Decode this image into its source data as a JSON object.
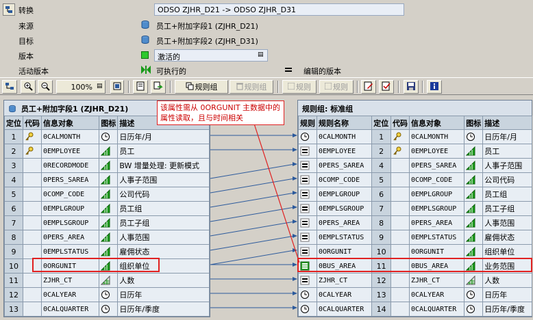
{
  "header": {
    "transform": {
      "label": "转换",
      "value": "ODSO ZJHR_D21 -> ODSO ZJHR_D31"
    },
    "source": {
      "label": "来源",
      "value": "员工+附加字段1 (ZJHR_D21)"
    },
    "target": {
      "label": "目标",
      "value": "员工+附加字段2 (ZJHR_D31)"
    },
    "version": {
      "label": "版本",
      "value": "激活的"
    },
    "active_version": {
      "label": "活动版本",
      "executable": "可执行的",
      "edited": "编辑的版本"
    }
  },
  "toolbar": {
    "zoom": "100%",
    "rule_group_active": "规则组",
    "rule_group_disabled": "规则组",
    "rule1": "规则",
    "rule2": "规则"
  },
  "callout": {
    "text": "该属性需从 0ORGUNIT 主数据中的属性读取，且与时间相关"
  },
  "left_panel": {
    "title": "员工+附加字段1 (ZJHR_D21)",
    "columns": [
      "定位",
      "代码",
      "信息对象",
      "图标",
      "描述"
    ],
    "rows": [
      {
        "pos": "1",
        "key": true,
        "obj": "0CALMONTH",
        "icon": "clock",
        "desc": "日历年/月"
      },
      {
        "pos": "2",
        "key": true,
        "obj": "0EMPLOYEE",
        "icon": "tri",
        "desc": "员工"
      },
      {
        "pos": "3",
        "key": false,
        "obj": "0RECORDMODE",
        "icon": "tri",
        "desc": "BW 增量处理: 更新模式"
      },
      {
        "pos": "4",
        "key": false,
        "obj": "0PERS_SAREA",
        "icon": "tri",
        "desc": "人事子范围"
      },
      {
        "pos": "5",
        "key": false,
        "obj": "0COMP_CODE",
        "icon": "tri",
        "desc": "公司代码"
      },
      {
        "pos": "6",
        "key": false,
        "obj": "0EMPLGROUP",
        "icon": "tri",
        "desc": "员工组"
      },
      {
        "pos": "7",
        "key": false,
        "obj": "0EMPLSGROUP",
        "icon": "tri",
        "desc": "员工子组"
      },
      {
        "pos": "8",
        "key": false,
        "obj": "0PERS_AREA",
        "icon": "tri",
        "desc": "人事范围"
      },
      {
        "pos": "9",
        "key": false,
        "obj": "0EMPLSTATUS",
        "icon": "tri",
        "desc": "雇佣状态"
      },
      {
        "pos": "10",
        "key": false,
        "obj": "0ORGUNIT",
        "icon": "tri",
        "desc": "组织单位"
      },
      {
        "pos": "11",
        "key": false,
        "obj": "ZJHR_CT",
        "icon": "grid",
        "desc": "人数"
      },
      {
        "pos": "12",
        "key": false,
        "obj": "0CALYEAR",
        "icon": "clock",
        "desc": "日历年"
      },
      {
        "pos": "13",
        "key": false,
        "obj": "0CALQUARTER",
        "icon": "clock",
        "desc": "日历年/季度"
      }
    ]
  },
  "right_panel": {
    "title": "规则组: 标准组",
    "columns": [
      "规则",
      "规则名称",
      "定位",
      "代码",
      "信息对象",
      "图标",
      "描述"
    ],
    "rows": [
      {
        "rule": "clock",
        "name": "0CALMONTH",
        "pos": "1",
        "key": true,
        "obj": "0CALMONTH",
        "icon": "clock",
        "desc": "日历年/月"
      },
      {
        "rule": "eq",
        "name": "0EMPLOYEE",
        "pos": "2",
        "key": true,
        "obj": "0EMPLOYEE",
        "icon": "tri",
        "desc": "员工"
      },
      {
        "rule": "eq",
        "name": "0PERS_SAREA",
        "pos": "4",
        "key": false,
        "obj": "0PERS_SAREA",
        "icon": "tri",
        "desc": "人事子范围"
      },
      {
        "rule": "eq",
        "name": "0COMP_CODE",
        "pos": "5",
        "key": false,
        "obj": "0COMP_CODE",
        "icon": "tri",
        "desc": "公司代码"
      },
      {
        "rule": "eq",
        "name": "0EMPLGROUP",
        "pos": "6",
        "key": false,
        "obj": "0EMPLGROUP",
        "icon": "tri",
        "desc": "员工组"
      },
      {
        "rule": "eq",
        "name": "0EMPLSGROUP",
        "pos": "7",
        "key": false,
        "obj": "0EMPLSGROUP",
        "icon": "tri",
        "desc": "员工子组"
      },
      {
        "rule": "eq",
        "name": "0PERS_AREA",
        "pos": "8",
        "key": false,
        "obj": "0PERS_AREA",
        "icon": "tri",
        "desc": "人事范围"
      },
      {
        "rule": "eq",
        "name": "0EMPLSTATUS",
        "pos": "9",
        "key": false,
        "obj": "0EMPLSTATUS",
        "icon": "tri",
        "desc": "雇佣状态"
      },
      {
        "rule": "eq",
        "name": "0ORGUNIT",
        "pos": "10",
        "key": false,
        "obj": "0ORGUNIT",
        "icon": "tri",
        "desc": "组织单位"
      },
      {
        "rule": "bars",
        "name": "0BUS_AREA",
        "pos": "11",
        "key": false,
        "obj": "0BUS_AREA",
        "icon": "tri",
        "desc": "业务范围"
      },
      {
        "rule": "eq",
        "name": "ZJHR_CT",
        "pos": "12",
        "key": false,
        "obj": "ZJHR_CT",
        "icon": "grid",
        "desc": "人数"
      },
      {
        "rule": "clock",
        "name": "0CALYEAR",
        "pos": "13",
        "key": false,
        "obj": "0CALYEAR",
        "icon": "clock",
        "desc": "日历年"
      },
      {
        "rule": "clock",
        "name": "0CALQUARTER",
        "pos": "14",
        "key": false,
        "obj": "0CALQUARTER",
        "icon": "clock",
        "desc": "日历年/季度"
      }
    ]
  },
  "mappings": [
    [
      1,
      1
    ],
    [
      2,
      2
    ],
    [
      4,
      3
    ],
    [
      5,
      4
    ],
    [
      6,
      5
    ],
    [
      7,
      6
    ],
    [
      8,
      7
    ],
    [
      9,
      8
    ],
    [
      10,
      9
    ],
    [
      10,
      10
    ],
    [
      11,
      11
    ],
    [
      12,
      12
    ],
    [
      13,
      13
    ]
  ],
  "colors": {
    "accent_red": "#e02020",
    "rule_green": "#2e9e2e",
    "connector_blue": "#2c5a9c"
  }
}
